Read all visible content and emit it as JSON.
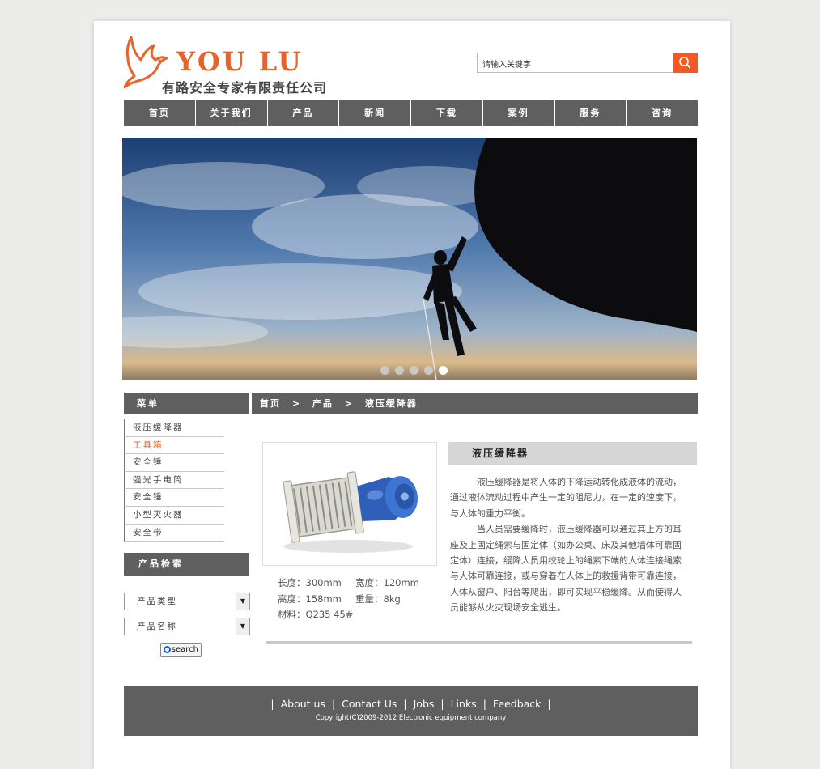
{
  "header": {
    "brand": "YOU LU",
    "company": "有路安全专家有限责任公司",
    "search_placeholder": "请输入关键字"
  },
  "nav": [
    "首页",
    "关于我们",
    "产品",
    "新闻",
    "下载",
    "案例",
    "服务",
    "咨询"
  ],
  "slider": {
    "dot_count": 5,
    "active_index": 4
  },
  "sidebar": {
    "menu_title": "菜单",
    "items": [
      "液压缓降器",
      "工具箱",
      "安全锤",
      "强光手电筒",
      "安全锤",
      "小型灭火器",
      "安全带"
    ],
    "active_item": 1,
    "search_title": "产品检索",
    "select_type": "产品类型",
    "select_name": "产品名称",
    "search_button": "search"
  },
  "breadcrumb": {
    "home": "首页",
    "sep": ">",
    "section": "产品",
    "current": "液压缓降器"
  },
  "product": {
    "title": "液压缓降器",
    "specs": {
      "length": "长度：300mm",
      "width": "宽度：120mm",
      "height": "高度：158mm",
      "weight": "重量：8kg",
      "material": "材料：Q235 45#"
    },
    "paragraph1": "液压缓降器是将人体的下降运动转化成液体的流动，通过液体流动过程中产生一定的阻尼力，在一定的速度下，与人体的重力平衡。",
    "paragraph2": "当人员需要缓降时，液压缓降器可以通过其上方的耳座及上固定绳索与固定体（如办公桌、床及其他墙体可靠固定体）连接，缓降人员用绞轮上的绳索下端的人体连接绳索与人体可靠连接，或与穿着在人体上的救援背带可靠连接，人体从窗户、阳台等爬出，即可实现平稳缓降。从而使得人员能够从火灾现场安全逃生。"
  },
  "footer": {
    "links": [
      "About us",
      "Contact Us",
      "Jobs",
      "Links",
      "Feedback"
    ],
    "copyright": "Copyright(C)2009-2012 Electronic equipment company"
  },
  "colors": {
    "accent": "#e8622a",
    "bar": "#5f5f5f",
    "title_bg": "#d6d6d6"
  }
}
